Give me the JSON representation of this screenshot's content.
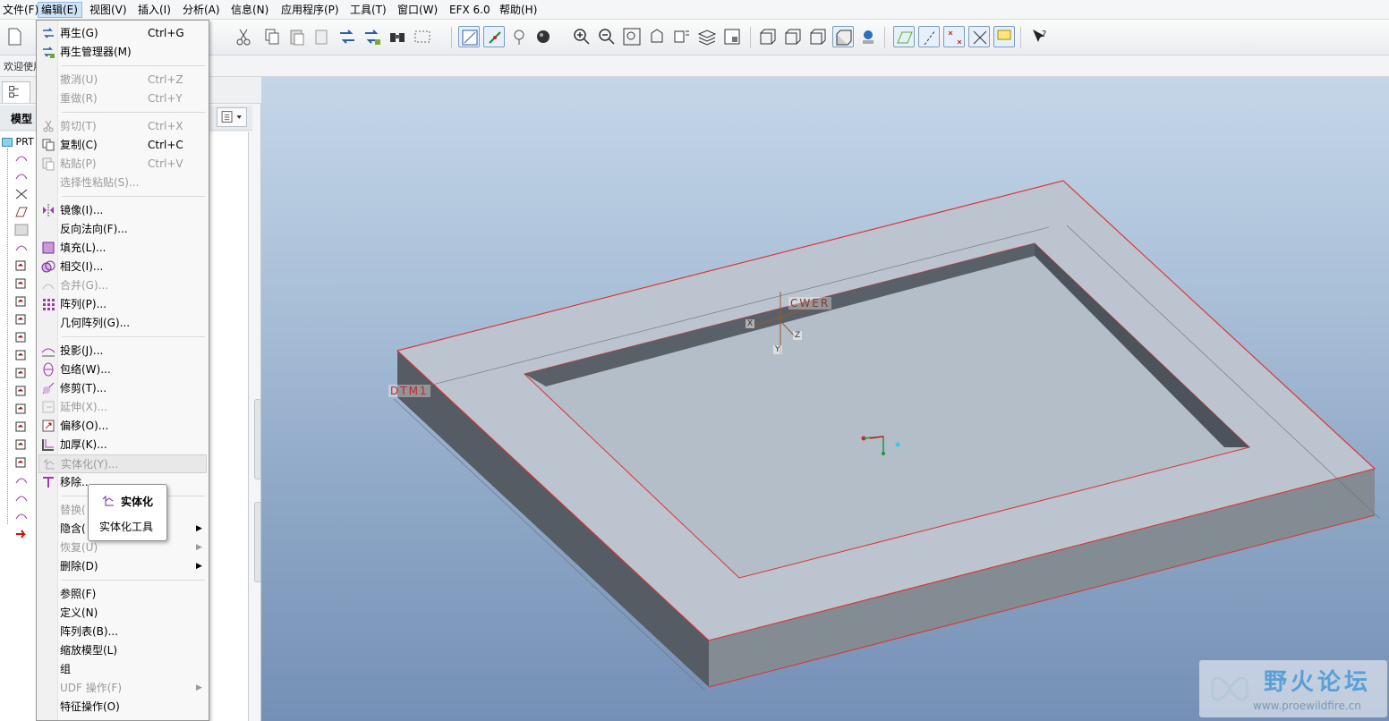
{
  "menubar": {
    "items": [
      {
        "label": "文件(F)"
      },
      {
        "label": "编辑(E)"
      },
      {
        "label": "视图(V)"
      },
      {
        "label": "插入(I)"
      },
      {
        "label": "分析(A)"
      },
      {
        "label": "信息(N)"
      },
      {
        "label": "应用程序(P)"
      },
      {
        "label": "工具(T)"
      },
      {
        "label": "窗口(W)"
      },
      {
        "label": "EFX 6.0"
      },
      {
        "label": "帮助(H)"
      }
    ]
  },
  "welcome": {
    "text": "欢迎使用"
  },
  "left_panel": {
    "title": "模型",
    "root_label": "PRT"
  },
  "edit_menu": {
    "items": [
      {
        "label": "再生(G)",
        "shortcut": "Ctrl+G",
        "icon": "regenerate-icon"
      },
      {
        "label": "再生管理器(M)",
        "shortcut": "",
        "icon": "regen-manager-icon"
      },
      {
        "label": "撤消(U)",
        "shortcut": "Ctrl+Z"
      },
      {
        "label": "重做(R)",
        "shortcut": "Ctrl+Y"
      },
      {
        "label": "剪切(T)",
        "shortcut": "Ctrl+X",
        "icon": "scissors-icon"
      },
      {
        "label": "复制(C)",
        "shortcut": "Ctrl+C",
        "icon": "copy-icon"
      },
      {
        "label": "粘贴(P)",
        "shortcut": "Ctrl+V",
        "icon": "paste-icon"
      },
      {
        "label": "选择性粘贴(S)...",
        "shortcut": "",
        "icon": "paste-special-icon"
      },
      {
        "label": "镜像(I)...",
        "icon": "mirror-icon"
      },
      {
        "label": "反向法向(F)..."
      },
      {
        "label": "填充(L)...",
        "icon": "fill-icon"
      },
      {
        "label": "相交(I)...",
        "icon": "intersect-icon"
      },
      {
        "label": "合并(G)...",
        "icon": "merge-icon"
      },
      {
        "label": "阵列(P)...",
        "icon": "pattern-icon"
      },
      {
        "label": "几何阵列(G)..."
      },
      {
        "label": "投影(J)...",
        "icon": "project-icon"
      },
      {
        "label": "包络(W)...",
        "icon": "wrap-icon"
      },
      {
        "label": "修剪(T)...",
        "icon": "trim-icon"
      },
      {
        "label": "延伸(X)...",
        "icon": "extend-icon"
      },
      {
        "label": "偏移(O)...",
        "icon": "offset-icon"
      },
      {
        "label": "加厚(K)...",
        "icon": "thicken-icon"
      },
      {
        "label": "实体化(Y)...",
        "icon": "solidify-icon"
      },
      {
        "label": "移除...",
        "icon": "remove-icon"
      },
      {
        "label": "替换(",
        "icon": ""
      },
      {
        "label": "隐含(",
        "icon": ""
      },
      {
        "label": "恢复(U)",
        "icon": ""
      },
      {
        "label": "删除(D)",
        "icon": ""
      },
      {
        "label": "参照(F)"
      },
      {
        "label": "定义(N)"
      },
      {
        "label": "阵列表(B)..."
      },
      {
        "label": "缩放模型(L)"
      },
      {
        "label": "组"
      },
      {
        "label": "UDF 操作(F)"
      },
      {
        "label": "特征操作(O)"
      }
    ]
  },
  "tooltip": {
    "title": "实体化",
    "desc": "实体化工具"
  },
  "scene": {
    "csys_label": "CWER",
    "datum_label": "DTM1",
    "axis_x": "X",
    "axis_y": "Y",
    "axis_z": "Z"
  },
  "watermark": {
    "title": "野火论坛",
    "url": "www.proewildfire.cn"
  },
  "colors": {
    "accent": "#cde4f7",
    "edge": "#e0322e",
    "part": "#bcc5cf"
  }
}
